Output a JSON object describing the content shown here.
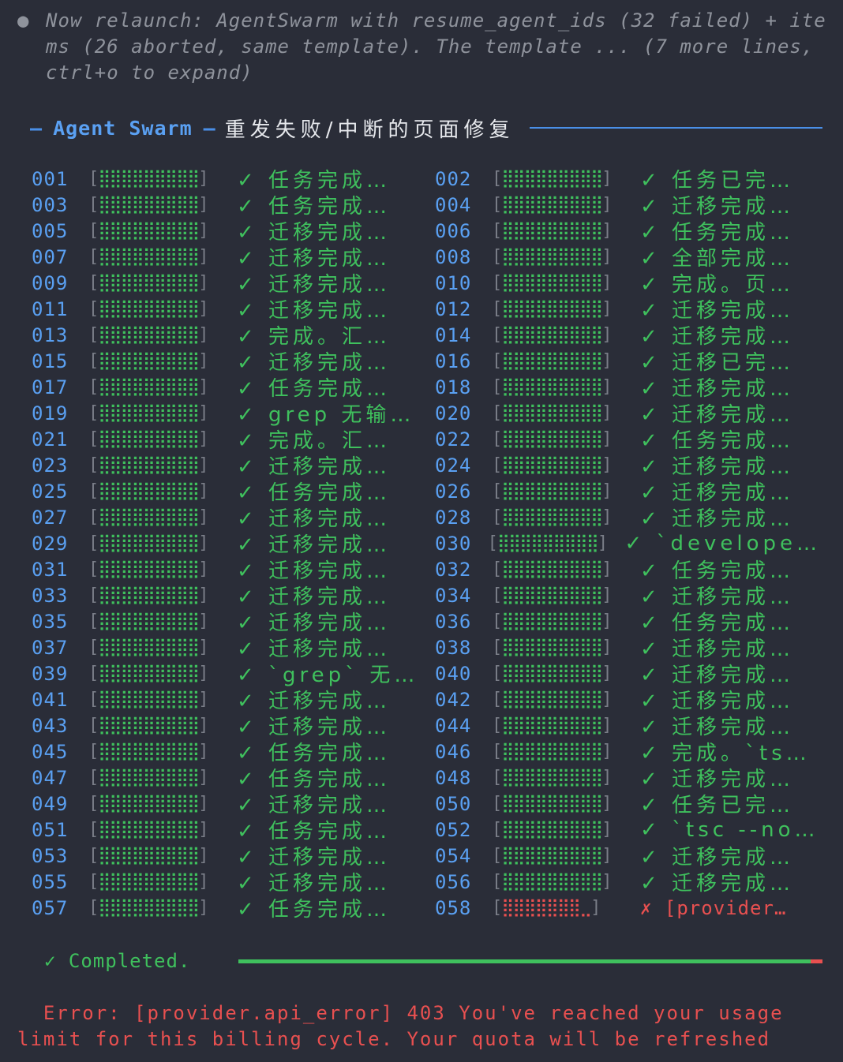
{
  "header": {
    "bullet": "●",
    "text": "Now relaunch: AgentSwarm with resume_agent_ids (32 failed) + items (26 aborted, same template). The template ... (7 more lines, ctrl+o to expand)"
  },
  "title": {
    "dash": "—",
    "name": "Agent Swarm",
    "subtitle": "重发失败/中断的页面修复"
  },
  "bar_glyphs": {
    "open": "[",
    "fill": "⣿⣿⣿⣿⣿⣿⣿⣿⣿",
    "close": "]",
    "fail_fill": "⣿⣿⣿⣿⣿⣿⣿⣀"
  },
  "agents": [
    {
      "id": "001",
      "status": "✓ 任务完成…"
    },
    {
      "id": "002",
      "status": "✓ 任务已完…"
    },
    {
      "id": "003",
      "status": "✓ 任务完成…"
    },
    {
      "id": "004",
      "status": "✓ 迁移完成…"
    },
    {
      "id": "005",
      "status": "✓ 迁移完成…"
    },
    {
      "id": "006",
      "status": "✓ 任务完成…"
    },
    {
      "id": "007",
      "status": "✓ 迁移完成…"
    },
    {
      "id": "008",
      "status": "✓ 全部完成…"
    },
    {
      "id": "009",
      "status": "✓ 迁移完成…"
    },
    {
      "id": "010",
      "status": "✓ 完成。页…"
    },
    {
      "id": "011",
      "status": "✓ 迁移完成…"
    },
    {
      "id": "012",
      "status": "✓ 迁移完成…"
    },
    {
      "id": "013",
      "status": "✓ 完成。汇…"
    },
    {
      "id": "014",
      "status": "✓ 迁移完成…"
    },
    {
      "id": "015",
      "status": "✓ 迁移完成…"
    },
    {
      "id": "016",
      "status": "✓ 迁移已完…"
    },
    {
      "id": "017",
      "status": "✓ 任务完成…"
    },
    {
      "id": "018",
      "status": "✓ 迁移完成…"
    },
    {
      "id": "019",
      "status": "✓ grep 无输…"
    },
    {
      "id": "020",
      "status": "✓ 迁移完成…"
    },
    {
      "id": "021",
      "status": "✓ 完成。汇…"
    },
    {
      "id": "022",
      "status": "✓ 任务完成…"
    },
    {
      "id": "023",
      "status": "✓ 迁移完成…"
    },
    {
      "id": "024",
      "status": "✓ 迁移完成…"
    },
    {
      "id": "025",
      "status": "✓ 任务完成…"
    },
    {
      "id": "026",
      "status": "✓ 迁移完成…"
    },
    {
      "id": "027",
      "status": "✓ 迁移完成…"
    },
    {
      "id": "028",
      "status": "✓ 迁移完成…"
    },
    {
      "id": "029",
      "status": "✓ 迁移完成…"
    },
    {
      "id": "030",
      "status": "✓ `develope…"
    },
    {
      "id": "031",
      "status": "✓ 迁移完成…"
    },
    {
      "id": "032",
      "status": "✓ 任务完成…"
    },
    {
      "id": "033",
      "status": "✓ 迁移完成…"
    },
    {
      "id": "034",
      "status": "✓ 迁移完成…"
    },
    {
      "id": "035",
      "status": "✓ 迁移完成…"
    },
    {
      "id": "036",
      "status": "✓ 任务完成…"
    },
    {
      "id": "037",
      "status": "✓ 迁移完成…"
    },
    {
      "id": "038",
      "status": "✓ 迁移完成…"
    },
    {
      "id": "039",
      "status": "✓ `grep` 无…"
    },
    {
      "id": "040",
      "status": "✓ 迁移完成…"
    },
    {
      "id": "041",
      "status": "✓ 迁移完成…"
    },
    {
      "id": "042",
      "status": "✓ 迁移完成…"
    },
    {
      "id": "043",
      "status": "✓ 迁移完成…"
    },
    {
      "id": "044",
      "status": "✓ 迁移完成…"
    },
    {
      "id": "045",
      "status": "✓ 任务完成…"
    },
    {
      "id": "046",
      "status": "✓ 完成。`ts…"
    },
    {
      "id": "047",
      "status": "✓ 任务完成…"
    },
    {
      "id": "048",
      "status": "✓ 迁移完成…"
    },
    {
      "id": "049",
      "status": "✓ 迁移完成…"
    },
    {
      "id": "050",
      "status": "✓ 任务已完…"
    },
    {
      "id": "051",
      "status": "✓ 任务完成…"
    },
    {
      "id": "052",
      "status": "✓ `tsc --no…"
    },
    {
      "id": "053",
      "status": "✓ 迁移完成…"
    },
    {
      "id": "054",
      "status": "✓ 迁移完成…"
    },
    {
      "id": "055",
      "status": "✓ 迁移完成…"
    },
    {
      "id": "056",
      "status": "✓ 迁移完成…"
    },
    {
      "id": "057",
      "status": "✓ 任务完成…"
    },
    {
      "id": "058",
      "status": "✗ [provider…",
      "failed": true
    }
  ],
  "completion": {
    "label": "✓ Completed.",
    "fraction": 0.98
  },
  "error": {
    "text": "  Error: [provider.api_error] 403 You've reached your usage limit for this billing cycle. Your quota will be refreshed"
  },
  "colors": {
    "success": "#3fc05d",
    "fail": "#e85050",
    "accent": "#5aa0f2",
    "background": "#2a2d38"
  }
}
